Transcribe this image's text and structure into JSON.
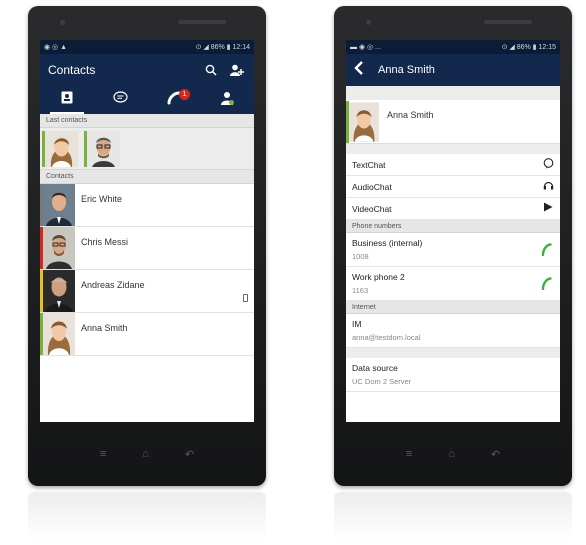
{
  "left_phone": {
    "status_bar": {
      "left_icons": "◉ ◎ ▲",
      "right": "⊙ ◢ 86% ▮ 12:14"
    },
    "header": {
      "title": "Contacts"
    },
    "tabs": [
      {
        "icon": "contacts-book-icon"
      },
      {
        "icon": "chat-bubble-icon"
      },
      {
        "icon": "phone-icon",
        "badge": "1"
      },
      {
        "icon": "presence-person-icon"
      }
    ],
    "last_contacts_header": "Last contacts",
    "contacts_header": "Contacts",
    "contacts": [
      {
        "name": "Eric White",
        "status_color": "#7a7a7a"
      },
      {
        "name": "Chris Messi",
        "status_color": "#d9261c"
      },
      {
        "name": "Andreas Zidane",
        "status_color": "#e3c41c"
      },
      {
        "name": "Anna Smith",
        "status_color": "#7ab03c"
      }
    ],
    "nav_keys": [
      "≡",
      "⌂",
      "↶"
    ]
  },
  "right_phone": {
    "status_bar": {
      "left_icons": "▬ ◉ ◎ ...",
      "right": "⊙ ◢ 86% ▮ 12:15"
    },
    "header": {
      "title": "Anna Smith"
    },
    "profile_name": "Anna Smith",
    "actions": [
      {
        "label": "TextChat",
        "icon": "chat-icon"
      },
      {
        "label": "AudioChat",
        "icon": "headset-icon"
      },
      {
        "label": "VideoChat",
        "icon": "play-icon"
      }
    ],
    "phone_numbers_header": "Phone numbers",
    "phones": [
      {
        "label": "Business (internal)",
        "number": "1008"
      },
      {
        "label": "Work phone 2",
        "number": "1163"
      }
    ],
    "internet_header": "Internet",
    "im": {
      "label": "IM",
      "value": "anna@testdom.local"
    },
    "data_source": {
      "label": "Data source",
      "value": "UC Dom 2 Server"
    },
    "nav_keys": [
      "≡",
      "⌂",
      "↶"
    ]
  },
  "colors": {
    "app_bar": "#13284d",
    "status_bar": "#0b1c36",
    "online": "#7ab03c",
    "busy": "#d9261c",
    "away": "#e3c41c",
    "offline": "#7a7a7a",
    "call_green": "#3fae49"
  }
}
